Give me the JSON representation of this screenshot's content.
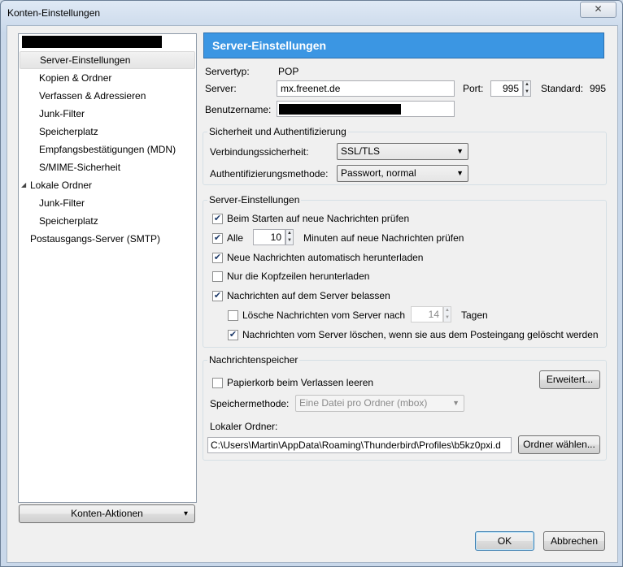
{
  "window": {
    "title": "Konten-Einstellungen",
    "close_glyph": "✕"
  },
  "tree": {
    "account_redacted": true,
    "items": [
      {
        "label": "Server-Einstellungen"
      },
      {
        "label": "Kopien & Ordner"
      },
      {
        "label": "Verfassen & Adressieren"
      },
      {
        "label": "Junk-Filter"
      },
      {
        "label": "Speicherplatz"
      },
      {
        "label": "Empfangsbestätigungen (MDN)"
      },
      {
        "label": "S/MIME-Sicherheit"
      },
      {
        "label": "Lokale Ordner"
      },
      {
        "label": "Junk-Filter"
      },
      {
        "label": "Speicherplatz"
      },
      {
        "label": "Postausgangs-Server (SMTP)"
      }
    ],
    "expander": "◢"
  },
  "account_actions": {
    "label": "Konten-Aktionen",
    "arrow": "▾"
  },
  "panel": {
    "header": "Server-Einstellungen",
    "servertype_label": "Servertyp:",
    "servertype_value": "POP",
    "server_label": "Server:",
    "server_value": "mx.freenet.de",
    "port_label": "Port:",
    "port_value": "995",
    "standard_label": "Standard:",
    "standard_value": "995",
    "username_label": "Benutzername:"
  },
  "security": {
    "title": "Sicherheit und Authentifizierung",
    "connection_label": "Verbindungssicherheit:",
    "connection_value": "SSL/TLS",
    "auth_label": "Authentifizierungsmethode:",
    "auth_value": "Passwort, normal"
  },
  "server_settings": {
    "title": "Server-Einstellungen",
    "check_on_start": "Beim Starten auf neue Nachrichten prüfen",
    "check_every_label": "Alle",
    "check_every_value": "10",
    "check_every_suffix": "Minuten auf neue Nachrichten prüfen",
    "auto_download": "Neue Nachrichten automatisch herunterladen",
    "headers_only": "Nur die Kopfzeilen herunterladen",
    "leave_on_server": "Nachrichten auf dem Server belassen",
    "delete_after": "Lösche Nachrichten vom Server nach",
    "delete_after_value": "14",
    "delete_after_suffix": "Tagen",
    "delete_when_deleted": "Nachrichten vom Server löschen, wenn sie aus dem Posteingang gelöscht werden",
    "check_mark": "✔"
  },
  "storage": {
    "title": "Nachrichtenspeicher",
    "empty_trash": "Papierkorb beim Verlassen leeren",
    "advanced_button": "Erweitert...",
    "method_label": "Speichermethode:",
    "method_value": "Eine Datei pro Ordner (mbox)",
    "local_folder_label": "Lokaler Ordner:",
    "local_folder_value": "C:\\Users\\Martin\\AppData\\Roaming\\Thunderbird\\Profiles\\b5kz0pxi.d",
    "choose_folder_button": "Ordner wählen..."
  },
  "footer": {
    "ok": "OK",
    "cancel": "Abbrechen"
  }
}
